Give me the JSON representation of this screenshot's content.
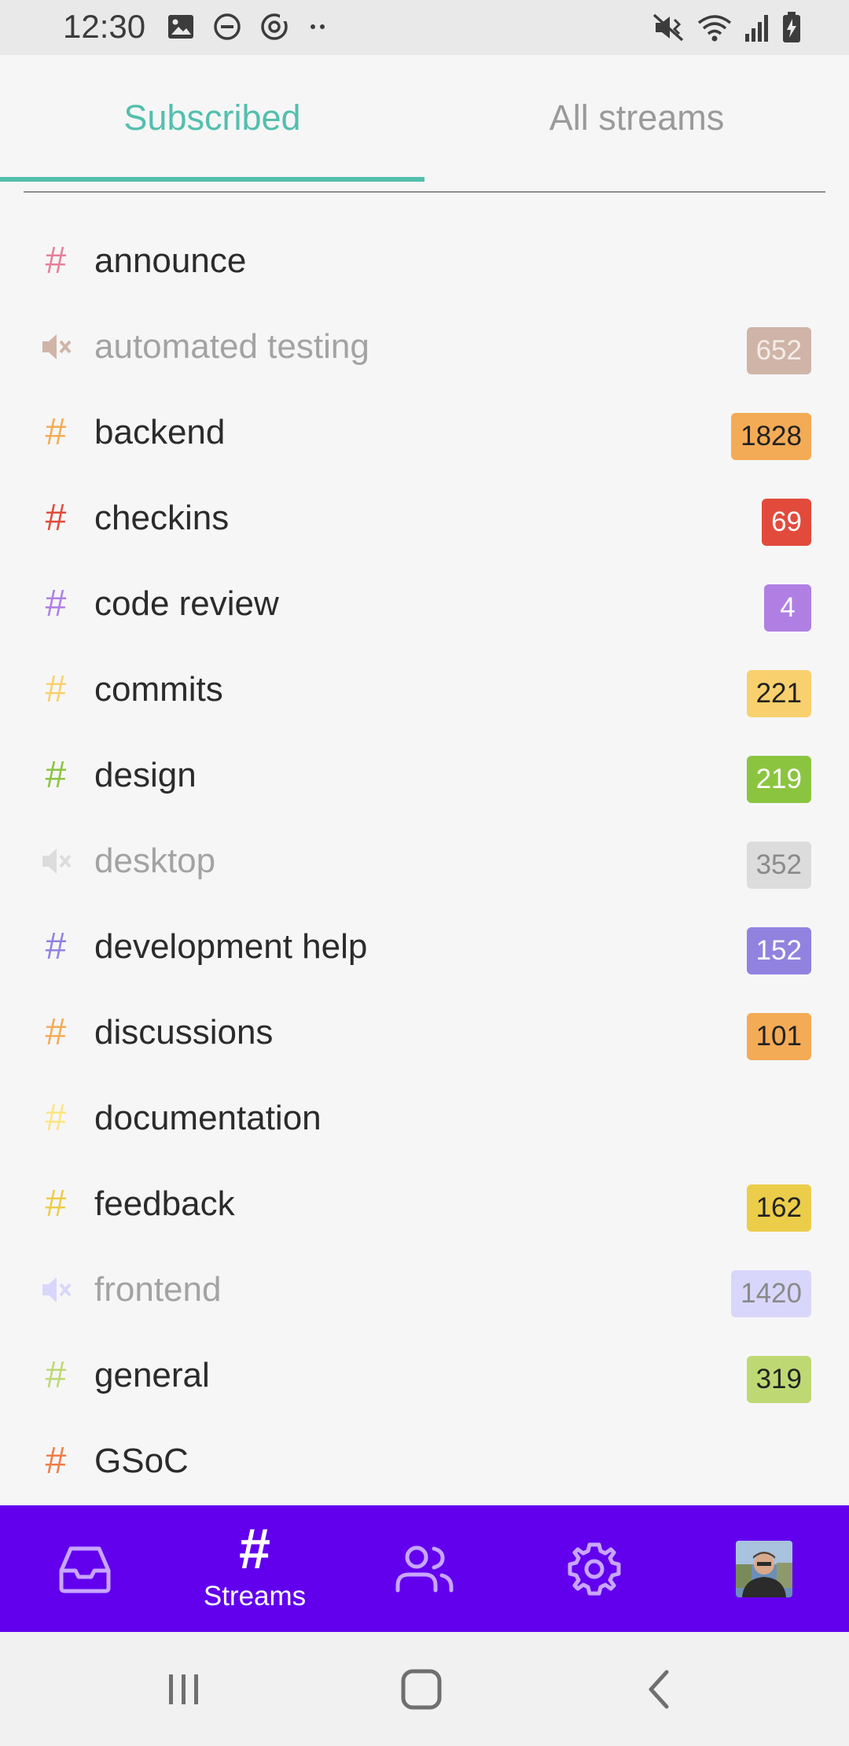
{
  "status_bar": {
    "time": "12:30"
  },
  "tabs": {
    "subscribed": "Subscribed",
    "all_streams": "All streams"
  },
  "streams": [
    {
      "name": "announce",
      "muted": false,
      "color": "#e57f9a",
      "count": ""
    },
    {
      "name": "automated testing",
      "muted": true,
      "color": "#d0b4a8",
      "count": "652"
    },
    {
      "name": "backend",
      "muted": false,
      "color": "#f4ab56",
      "count": "1828"
    },
    {
      "name": "checkins",
      "muted": false,
      "color": "#e24b3c",
      "count": "69"
    },
    {
      "name": "code review",
      "muted": false,
      "color": "#b07fe3",
      "count": "4"
    },
    {
      "name": "commits",
      "muted": false,
      "color": "#f8d06e",
      "count": "221"
    },
    {
      "name": "design",
      "muted": false,
      "color": "#8bc540",
      "count": "219"
    },
    {
      "name": "desktop",
      "muted": true,
      "color": "#dcdcdc",
      "count": "352"
    },
    {
      "name": "development help",
      "muted": false,
      "color": "#9182e0",
      "count": "152"
    },
    {
      "name": "discussions",
      "muted": false,
      "color": "#f4ab56",
      "count": "101"
    },
    {
      "name": "documentation",
      "muted": false,
      "color": "#fbe67e",
      "count": ""
    },
    {
      "name": "feedback",
      "muted": false,
      "color": "#eccd4a",
      "count": "162"
    },
    {
      "name": "frontend",
      "muted": true,
      "color": "#d9d6fb",
      "count": "1420"
    },
    {
      "name": "general",
      "muted": false,
      "color": "#bed974",
      "count": "319"
    },
    {
      "name": "GSoC",
      "muted": false,
      "color": "#ef7d46",
      "count": ""
    }
  ],
  "bottom_nav": {
    "items": [
      {
        "name": "inbox",
        "icon": "inbox-icon",
        "label": ""
      },
      {
        "name": "streams",
        "icon": "hash-icon",
        "label": "Streams"
      },
      {
        "name": "people",
        "icon": "people-icon",
        "label": ""
      },
      {
        "name": "settings",
        "icon": "gear-icon",
        "label": ""
      },
      {
        "name": "profile",
        "icon": "avatar",
        "label": ""
      }
    ],
    "background": "#6200ee",
    "icon_color": "#c8a6ff"
  },
  "accent": "#53bfad"
}
